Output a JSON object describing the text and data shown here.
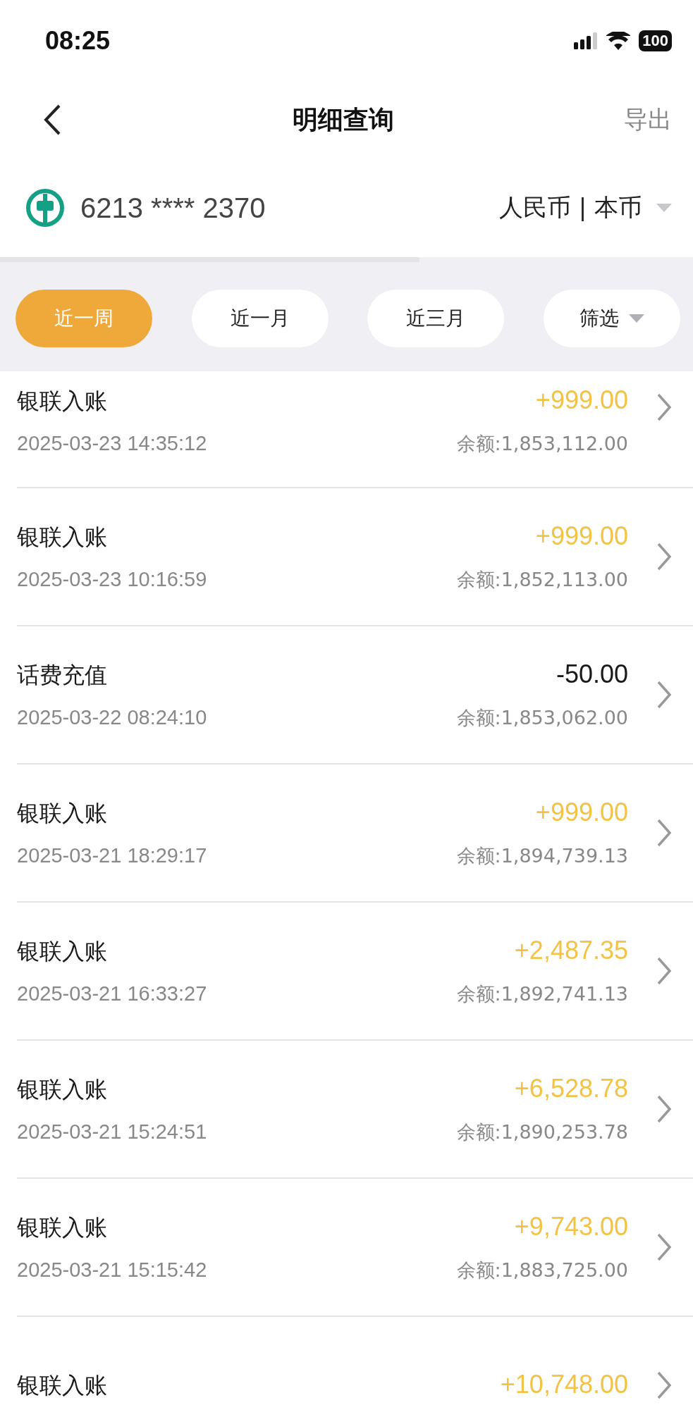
{
  "status_bar": {
    "time": "08:25",
    "battery": "100"
  },
  "nav": {
    "title": "明细查询",
    "action": "导出"
  },
  "account": {
    "number": "6213 **** 2370",
    "currency": "人民币 | 本币"
  },
  "filters": [
    {
      "label": "近一周",
      "selected": true,
      "dropdown": false
    },
    {
      "label": "近一月",
      "selected": false,
      "dropdown": false
    },
    {
      "label": "近三月",
      "selected": false,
      "dropdown": false
    },
    {
      "label": "筛选",
      "selected": false,
      "dropdown": true
    }
  ],
  "transactions": [
    {
      "title": "银联入账",
      "amount": "+999.00",
      "kind": "income",
      "time": "2025-03-23 14:35:12",
      "balance": "余额:1,853,112.00"
    },
    {
      "title": "银联入账",
      "amount": "+999.00",
      "kind": "income",
      "time": "2025-03-23 10:16:59",
      "balance": "余额:1,852,113.00"
    },
    {
      "title": "话费充值",
      "amount": "-50.00",
      "kind": "expense",
      "time": "2025-03-22 08:24:10",
      "balance": "余额:1,853,062.00"
    },
    {
      "title": "银联入账",
      "amount": "+999.00",
      "kind": "income",
      "time": "2025-03-21 18:29:17",
      "balance": "余额:1,894,739.13"
    },
    {
      "title": "银联入账",
      "amount": "+2,487.35",
      "kind": "income",
      "time": "2025-03-21 16:33:27",
      "balance": "余额:1,892,741.13"
    },
    {
      "title": "银联入账",
      "amount": "+6,528.78",
      "kind": "income",
      "time": "2025-03-21 15:24:51",
      "balance": "余额:1,890,253.78"
    },
    {
      "title": "银联入账",
      "amount": "+9,743.00",
      "kind": "income",
      "time": "2025-03-21 15:15:42",
      "balance": "余额:1,883,725.00"
    },
    {
      "title": "银联入账",
      "amount": "+10,748.00",
      "kind": "income"
    }
  ]
}
